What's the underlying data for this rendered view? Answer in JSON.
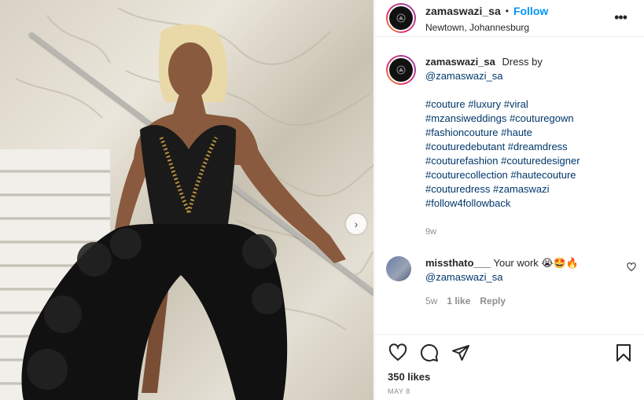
{
  "post": {
    "username": "zamaswazi_sa",
    "follow_label": "Follow",
    "separator": "•",
    "location": "Newtown, Johannesburg",
    "more_label": "•••"
  },
  "caption": {
    "username": "zamaswazi_sa",
    "text": "Dress by",
    "mention": "@zamaswazi_sa",
    "hashtags": [
      "#couture #luxury #viral",
      "#mzansiweddings #couturegown",
      "#fashioncouture #haute",
      "#couturedebutant #dreamdress",
      "#couturefashion #couturedesigner",
      "#couturecollection #hautecouture",
      "#couturedress #zamaswazi",
      "#follow4followback"
    ],
    "age": "9w"
  },
  "comment": {
    "username": "missthato___",
    "text": "Your work 😭🤩🔥",
    "mention": "@zamaswazi_sa",
    "age": "5w",
    "likes": "1 like",
    "reply_label": "Reply"
  },
  "actions": {
    "likes": "350 likes",
    "date": "MAY 8"
  },
  "colors": {
    "accent": "#0095f6",
    "text": "#262626",
    "muted": "#8e8e8e",
    "link": "#00376b"
  },
  "icons": {
    "like": "heart-icon",
    "comment": "comment-icon",
    "share": "share-icon",
    "save": "bookmark-icon",
    "next": "chevron-right-icon"
  }
}
